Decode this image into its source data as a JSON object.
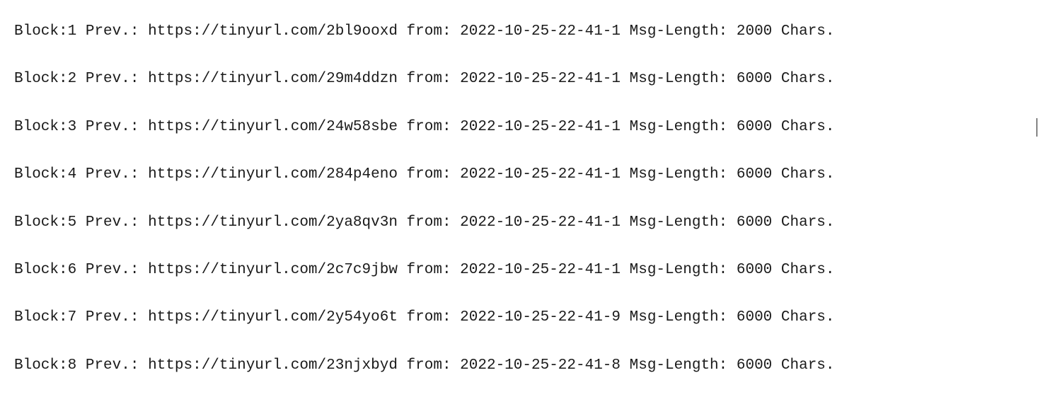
{
  "labels": {
    "block": "Block:",
    "prev": "Prev.:",
    "from": "from:",
    "msg_length": "Msg-Length:",
    "chars": "Chars."
  },
  "rows": [
    {
      "block": "1",
      "prev_url": "https://tinyurl.com/2bl9ooxd",
      "from": "2022-10-25-22-41-1",
      "msg_length": "2000"
    },
    {
      "block": "2",
      "prev_url": "https://tinyurl.com/29m4ddzn",
      "from": "2022-10-25-22-41-1",
      "msg_length": "6000"
    },
    {
      "block": "3",
      "prev_url": "https://tinyurl.com/24w58sbe",
      "from": "2022-10-25-22-41-1",
      "msg_length": "6000"
    },
    {
      "block": "4",
      "prev_url": "https://tinyurl.com/284p4eno",
      "from": "2022-10-25-22-41-1",
      "msg_length": "6000"
    },
    {
      "block": "5",
      "prev_url": "https://tinyurl.com/2ya8qv3n",
      "from": "2022-10-25-22-41-1",
      "msg_length": "6000"
    },
    {
      "block": "6",
      "prev_url": "https://tinyurl.com/2c7c9jbw",
      "from": "2022-10-25-22-41-1",
      "msg_length": "6000"
    },
    {
      "block": "7",
      "prev_url": "https://tinyurl.com/2y54yo6t",
      "from": "2022-10-25-22-41-9",
      "msg_length": "6000"
    },
    {
      "block": "8",
      "prev_url": "https://tinyurl.com/23njxbyd",
      "from": "2022-10-25-22-41-8",
      "msg_length": "6000"
    }
  ],
  "cursor_row_index": 2
}
